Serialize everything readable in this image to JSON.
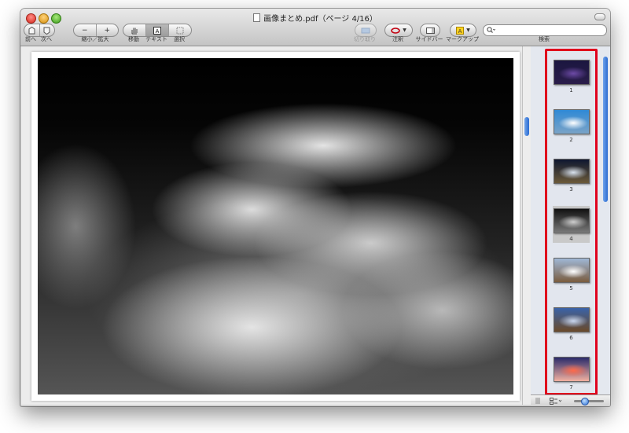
{
  "window": {
    "title": "画像まとめ.pdf（ページ 4/16）"
  },
  "toolbar": {
    "prev_label": "前へ",
    "next_label": "次へ",
    "zoom_out_glyph": "−",
    "zoom_in_glyph": "+",
    "zoom_label": "縮小／拡大",
    "move_label": "移動",
    "text_label": "テキスト",
    "select_label": "選択",
    "crop_label": "切り取り",
    "annotate_label": "注釈",
    "sidebar_label": "サイドバー",
    "markup_label": "マークアップ",
    "search_label": "検索",
    "search_value": ""
  },
  "sidebar": {
    "thumbnails": [
      {
        "page": "1",
        "colors": [
          "#1b1640",
          "#6d4aa6",
          "#2a1d4a"
        ]
      },
      {
        "page": "2",
        "colors": [
          "#2f89d6",
          "#ffffff",
          "#7aa3c7"
        ]
      },
      {
        "page": "3",
        "colors": [
          "#0e1730",
          "#d9e3ef",
          "#6b5a3a"
        ]
      },
      {
        "page": "4",
        "colors": [
          "#111111",
          "#cfcfcf",
          "#7a7a7a"
        ]
      },
      {
        "page": "5",
        "colors": [
          "#9fb7d6",
          "#ffffff",
          "#7a5c3f"
        ]
      },
      {
        "page": "6",
        "colors": [
          "#3a63a8",
          "#c9d7ef",
          "#6a4a2a"
        ]
      },
      {
        "page": "7",
        "colors": [
          "#2a2a6a",
          "#ff6a4a",
          "#f2b0a0"
        ]
      }
    ],
    "selected_page": "4"
  },
  "colors": {
    "highlight_border": "#e0001c",
    "accent": "#2b6bd1"
  }
}
